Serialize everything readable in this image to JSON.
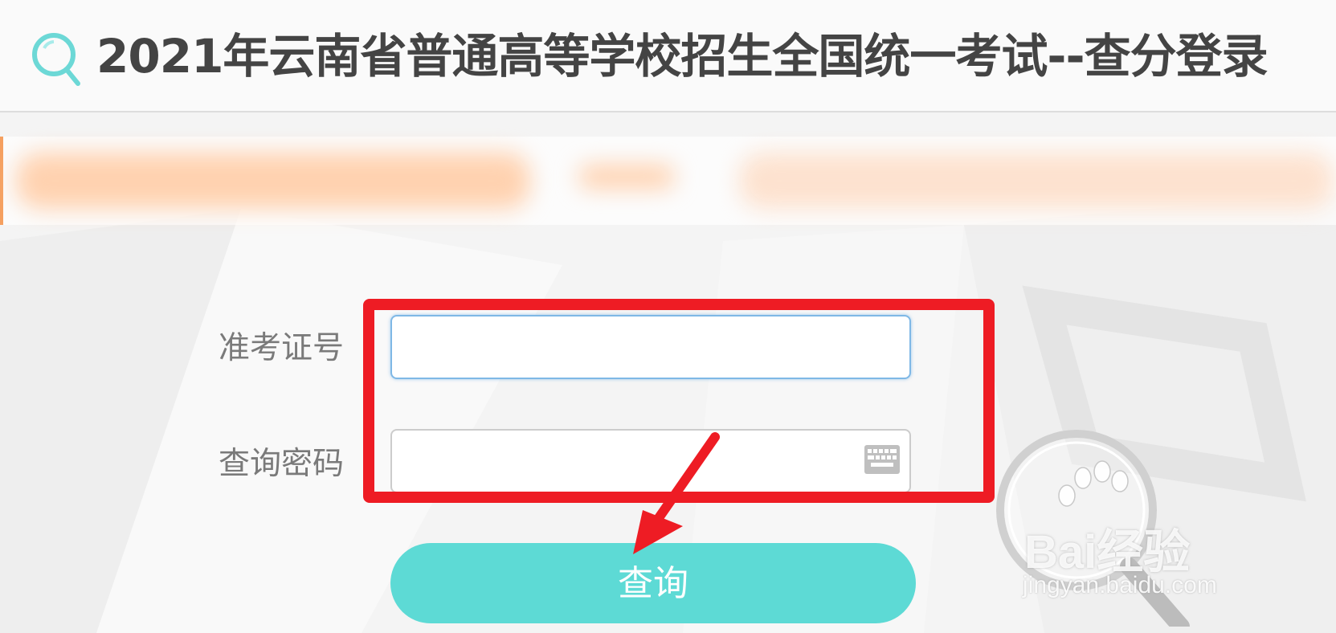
{
  "header": {
    "title": "2021年云南省普通高等学校招生全国统一考试--查分登录"
  },
  "form": {
    "exam_id_label": "准考证号",
    "exam_id_value": "",
    "password_label": "查询密码",
    "password_value": "",
    "submit_label": "查询"
  },
  "watermark": {
    "brand": "Bai经验",
    "url": "jingyan.baidu.com"
  },
  "colors": {
    "accent": "#5ddad5",
    "annotation": "#ee1c24",
    "label": "#7a7a7a",
    "title": "#444444"
  }
}
